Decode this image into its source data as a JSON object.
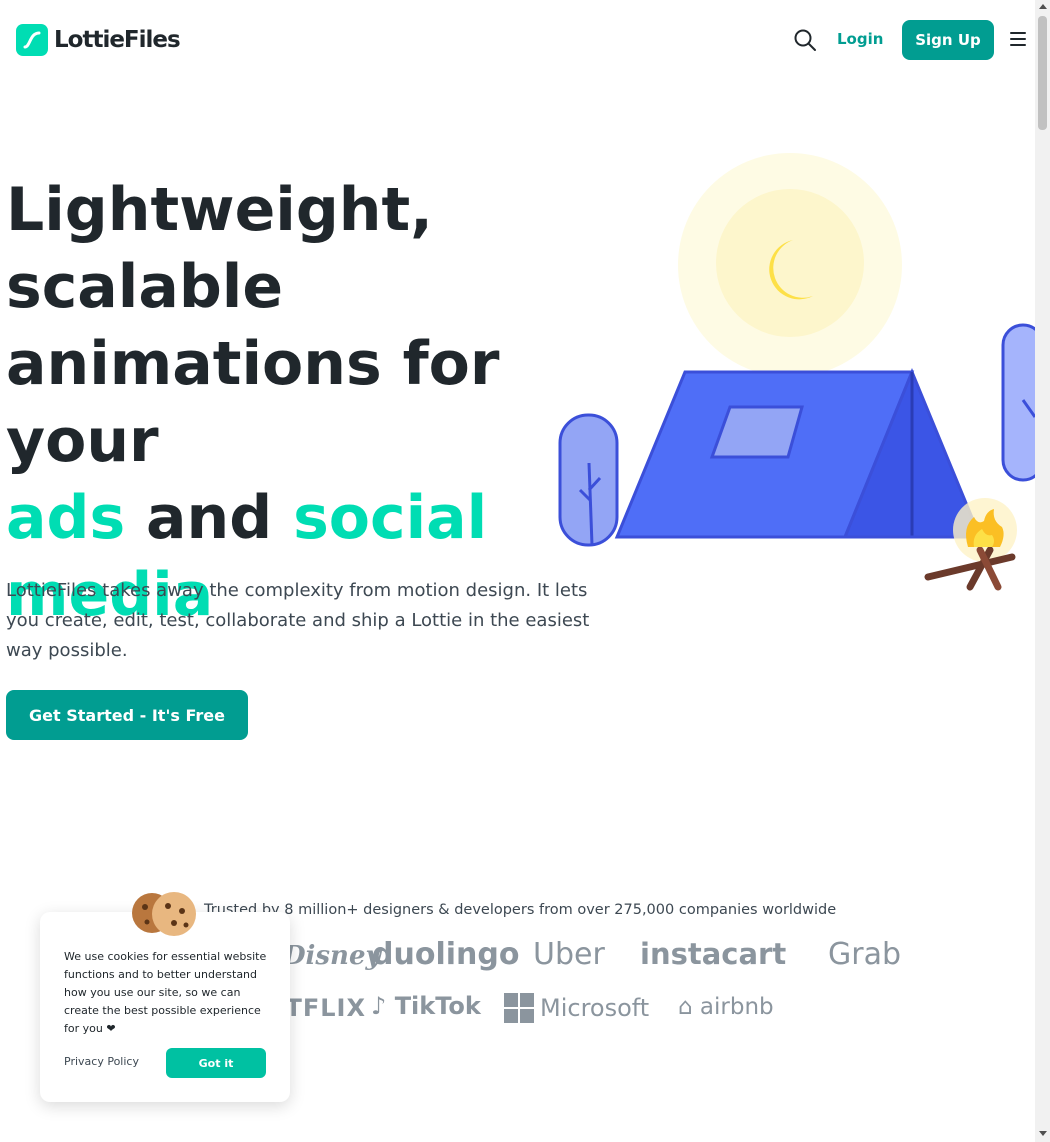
{
  "header": {
    "logo_text": "LottieFiles",
    "login_label": "Login",
    "signup_label": "Sign Up",
    "icons": [
      "lottiefiles-logo-icon",
      "search-icon",
      "hamburger-menu-icon"
    ]
  },
  "hero": {
    "title_line1": "Lightweight,",
    "title_line2": "scalable",
    "title_line3": "animations for your",
    "title_accent1": "ads",
    "title_and": "and",
    "title_accent2": "social",
    "title_accent3": "media",
    "subtitle": "LottieFiles takes away the complexity from motion design. It lets you create, edit, test, collaborate and ship a Lottie in the easiest way possible.",
    "cta_label": "Get Started - It's Free"
  },
  "trusted": {
    "text": "Trusted by 8 million+ designers & developers from over 275,000 companies worldwide",
    "brands_row1": [
      "Disney",
      "duolingo",
      "Uber",
      "instacart",
      "Grab"
    ],
    "brands_row2": [
      "NETFLIX",
      "TikTok",
      "Microsoft",
      "airbnb"
    ]
  },
  "cookie": {
    "text": "We use cookies for essential website functions and to better understand how you use our site, so we can create the best possible experience for you ❤",
    "privacy_label": "Privacy Policy",
    "accept_label": "Got it"
  },
  "colors": {
    "accent": "#00ddb3",
    "primary": "#019d91",
    "text": "#20272c"
  }
}
